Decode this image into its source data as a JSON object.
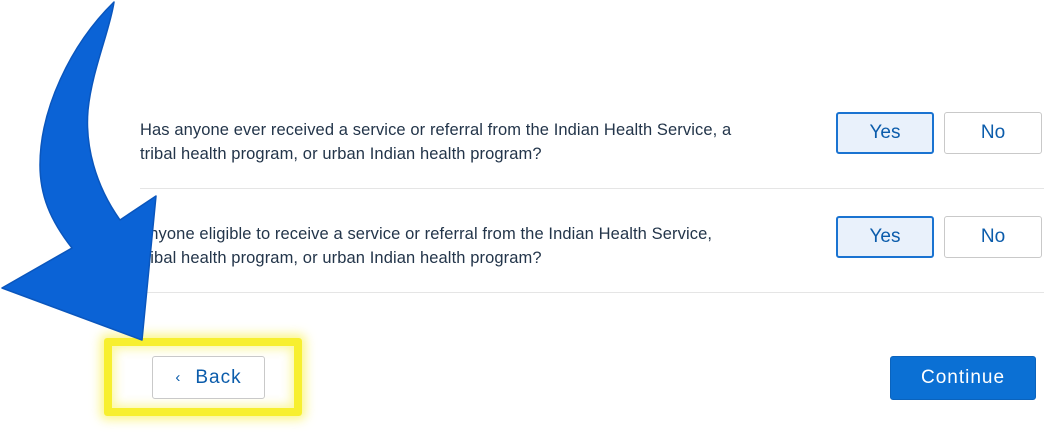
{
  "questions": [
    {
      "text_line1": "Has anyone ever received a service or referral from the Indian Health Service, a",
      "text_line2": "tribal health program, or urban Indian health program?",
      "yes_label": "Yes",
      "no_label": "No",
      "selected": "Yes"
    },
    {
      "text_line1": "anyone eligible to receive a service or referral from the Indian Health Service,",
      "text_line2": "tribal health program, or urban Indian health program?",
      "yes_label": "Yes",
      "no_label": "No",
      "selected": "Yes"
    }
  ],
  "footer": {
    "back_label": "Back",
    "back_icon": "chevron-left-icon",
    "continue_label": "Continue"
  },
  "annotation": {
    "arrow_icon": "curved-arrow-icon",
    "arrow_color": "#0b63d6",
    "highlight_color": "#f7ef2f"
  },
  "colors": {
    "accent": "#0b70d4",
    "selected_bg": "#e9f1fb",
    "text": "#23354a"
  }
}
